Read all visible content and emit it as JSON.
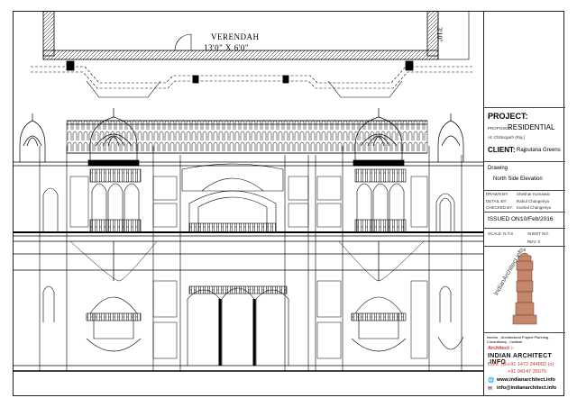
{
  "plan": {
    "room_label": "VERENDAH",
    "room_size": "13'0\" X 6'0\"",
    "dimension": "3'10\""
  },
  "title_block": {
    "project_heading": "PROJECT:",
    "proposed_label": "PROPOSED",
    "project_name": "RESIDENTIAL",
    "location": "At: Chittorgarh (Raj.)",
    "client_label": "CLIENT:",
    "client_name": "Rajputana Greens",
    "drawing_label": "Drawing",
    "drawing_name": "North Side Elevation",
    "drawn_by_label": "DRAWN BY:",
    "drawn_by": "Shekhar Kumawat",
    "detail_by_label": "DETAIL BY:",
    "detail_by": "Rahul Changeriya",
    "checked_by_label": "CHECKED BY:",
    "checked_by": "Kushal Changeriya",
    "issued_label": "ISSUED ON:",
    "issued_on": "10/Feb/2016",
    "scale_label": "SCALE: N.T.S",
    "sheet_label": "SHEET NO.",
    "rev_label": "REV: 0",
    "logo_watermark": "IndianArchitect.info",
    "services": "Interior , Architectural Project Planning , Consultancy , Institute .",
    "architect_label": "Architect :-",
    "brand": "INDIAN ARCHITECT .INFO",
    "contact_label": "Cont. No.",
    "phone_1": "+91 1472 244802 (o)",
    "phone_2": "+91 94147 35075",
    "website": "www.indianarchitect.info",
    "email": "info@indianarchitect.info"
  },
  "colors": {
    "line": "#000000",
    "accent": "#c0392b",
    "tower": "#c4876a"
  }
}
